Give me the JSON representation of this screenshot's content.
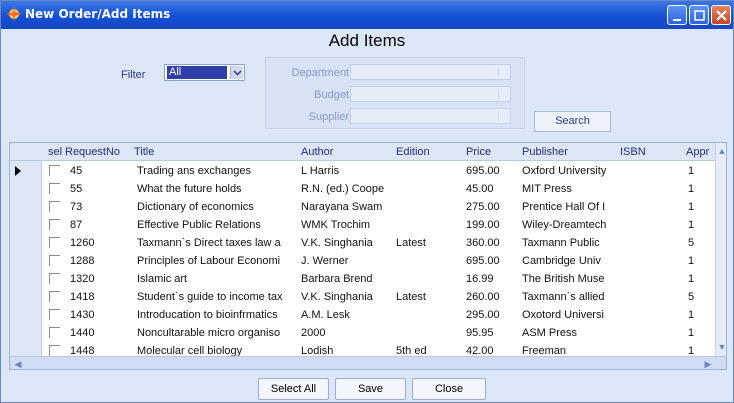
{
  "window": {
    "title": "New Order/Add Items"
  },
  "heading": "Add Items",
  "filter": {
    "label": "Filter",
    "value": "All"
  },
  "fields": {
    "department_label": "Department",
    "budget_label": "Budget",
    "supplier_label": "Supplier"
  },
  "search_label": "Search",
  "grid": {
    "columns": [
      "sel",
      "RequestNo",
      "Title",
      "Author",
      "Edition",
      "Price",
      "Publisher",
      "ISBN",
      "Appr"
    ],
    "rows": [
      {
        "req": "45",
        "title": "Trading ans exchanges",
        "author": "L Harris",
        "edition": "",
        "price": "695.00",
        "publisher": "Oxford University",
        "appr": "1"
      },
      {
        "req": "55",
        "title": "What the future holds",
        "author": "R.N. (ed.) Coope",
        "edition": "",
        "price": "45.00",
        "publisher": "MIT Press",
        "appr": "1"
      },
      {
        "req": "73",
        "title": "Dictionary of economics",
        "author": "Narayana Swam",
        "edition": "",
        "price": "275.00",
        "publisher": "Prentice Hall Of I",
        "appr": "1"
      },
      {
        "req": "87",
        "title": "Effective Public Relations",
        "author": "WMK Trochim",
        "edition": "",
        "price": "199.00",
        "publisher": "Wiley-Dreamtech",
        "appr": "1"
      },
      {
        "req": "1260",
        "title": "Taxmann`s Direct taxes law a",
        "author": "V.K. Singhania",
        "edition": "Latest",
        "price": "360.00",
        "publisher": "Taxmann Public",
        "appr": "5"
      },
      {
        "req": "1288",
        "title": "Principles of Labour Economi",
        "author": "J. Werner",
        "edition": "",
        "price": "695.00",
        "publisher": "Cambridge Univ",
        "appr": "1"
      },
      {
        "req": "1320",
        "title": "Islamic art",
        "author": "Barbara Brend",
        "edition": "",
        "price": "16.99",
        "publisher": "The British Muse",
        "appr": "1"
      },
      {
        "req": "1418",
        "title": "Student`s guide to income tax",
        "author": "V.K. Singhania",
        "edition": "Latest",
        "price": "260.00",
        "publisher": "Taxmann`s allied",
        "appr": "5"
      },
      {
        "req": "1430",
        "title": "Introducation to bioinfrmatics",
        "author": "A.M. Lesk",
        "edition": "",
        "price": "295.00",
        "publisher": "Oxotord Universi",
        "appr": "1"
      },
      {
        "req": "1440",
        "title": "Noncultarable micro organiso",
        "author": "2000",
        "edition": "",
        "price": "95.95",
        "publisher": "ASM Press",
        "appr": "1"
      },
      {
        "req": "1448",
        "title": "Molecular cell biology",
        "author": "Lodish",
        "edition": "5th ed",
        "price": "42.00",
        "publisher": "Freeman",
        "appr": "1"
      }
    ]
  },
  "buttons": {
    "select_all": "Select All",
    "save": "Save",
    "close": "Close"
  }
}
